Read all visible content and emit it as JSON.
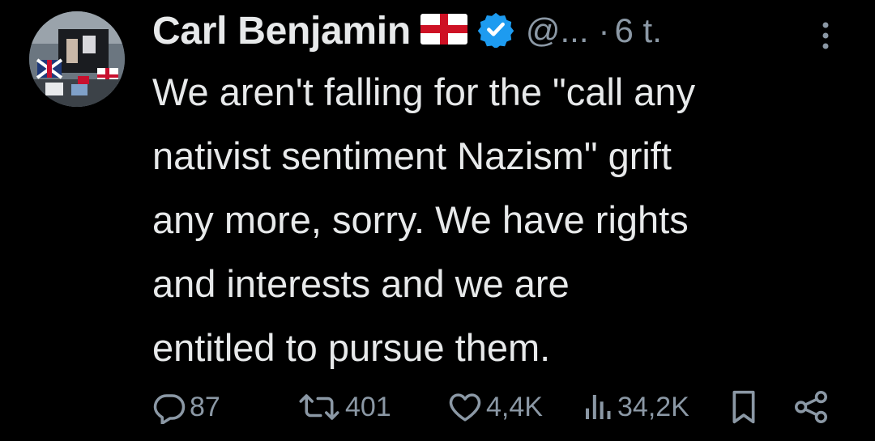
{
  "tweet": {
    "author_name": "Carl Benjamin",
    "flag_icon": "england-flag-icon",
    "verified_icon": "verified-badge-icon",
    "handle": "@...",
    "separator": "·",
    "time": "6 t.",
    "more_icon": "more-vertical-icon",
    "text_lines": [
      "We aren't falling for the \"call any",
      "nativist sentiment Nazism\" grift",
      "any more, sorry. We have rights",
      "and interests and we are",
      "entitled to pursue them."
    ]
  },
  "actions": {
    "replies": {
      "icon": "reply-icon",
      "count": "87"
    },
    "reposts": {
      "icon": "repost-icon",
      "count": "401"
    },
    "likes": {
      "icon": "heart-icon",
      "count": "4,4K"
    },
    "views": {
      "icon": "views-icon",
      "count": "34,2K"
    },
    "bookmark": {
      "icon": "bookmark-icon"
    },
    "share": {
      "icon": "share-icon"
    }
  },
  "colors": {
    "background": "#000000",
    "text": "#e7e9ea",
    "muted": "#8b98a5",
    "verified": "#1d9bf0"
  }
}
